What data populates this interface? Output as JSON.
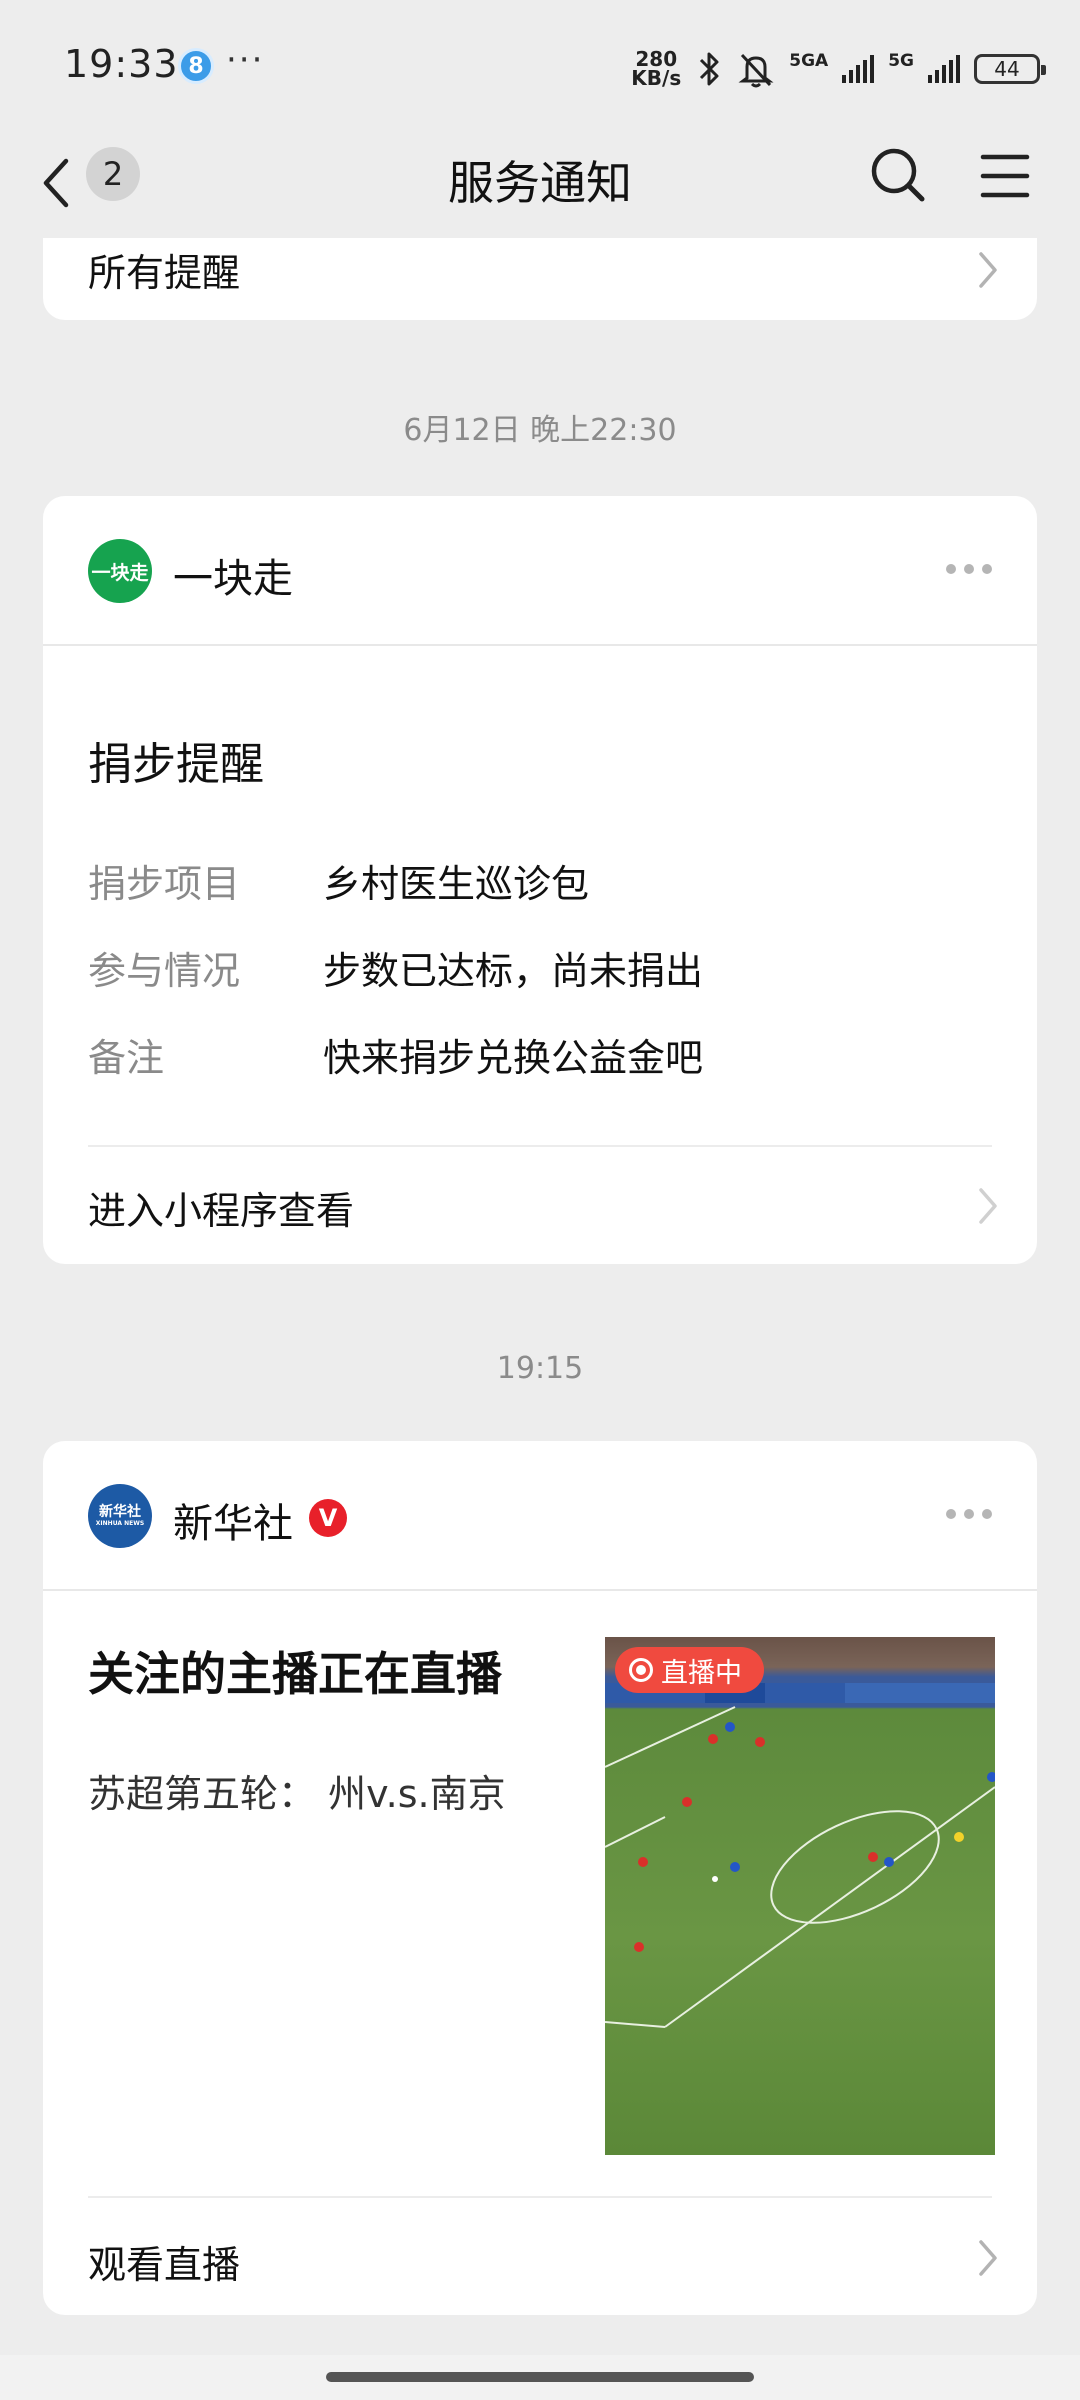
{
  "status_bar": {
    "time": "19:33",
    "badge": "8",
    "dots": "···",
    "speed_value": "280",
    "speed_unit": "KB/s",
    "net1": "5GA",
    "net2": "5G",
    "battery": "44"
  },
  "nav": {
    "unread_count": "2",
    "title": "服务通知"
  },
  "top_card": {
    "label": "所有提醒"
  },
  "timestamps": {
    "first": "6月12日 晚上22:30",
    "second": "19:15"
  },
  "card1": {
    "avatar_text": "一块走",
    "name": "一块走",
    "title": "捐步提醒",
    "rows": [
      {
        "label": "捐步项目",
        "value": "乡村医生巡诊包"
      },
      {
        "label": "参与情况",
        "value": "步数已达标，尚未捐出"
      },
      {
        "label": "备注",
        "value": "快来捐步兑换公益金吧"
      }
    ],
    "action": "进入小程序查看"
  },
  "card2": {
    "avatar_text": "新华社",
    "avatar_sub": "XINHUA NEWS",
    "name": "新华社",
    "verified": "V",
    "title": "关注的主播正在直播",
    "subtitle": "苏超第五轮：  州v.s.南京",
    "live_label": "直播中",
    "action": "观看直播"
  },
  "colors": {
    "background": "#ededed",
    "card": "#ffffff",
    "accent_green": "#16a34f",
    "live_red": "#f04a3f",
    "verified_red": "#e8202a"
  }
}
